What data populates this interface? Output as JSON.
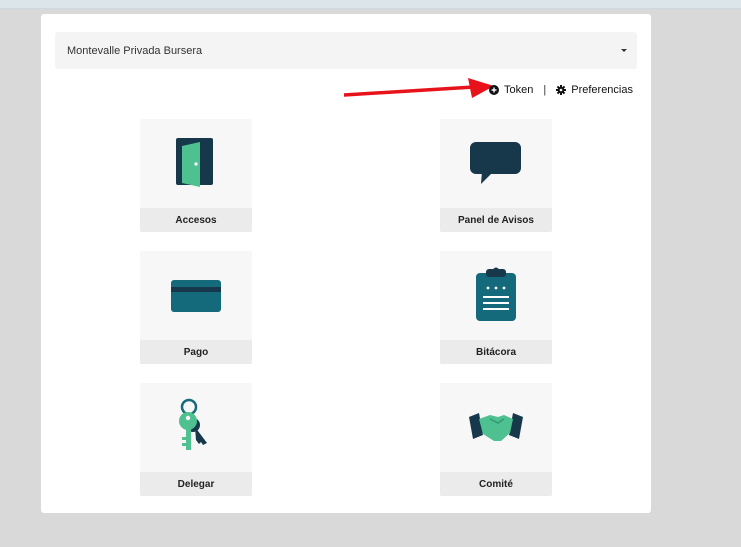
{
  "select": {
    "value": "Montevalle Privada Bursera"
  },
  "links": {
    "token_label": "Token",
    "separator": "|",
    "preferences_label": "Preferencias"
  },
  "tiles": [
    {
      "label": "Accesos",
      "icon": "door-icon"
    },
    {
      "label": "Panel de Avisos",
      "icon": "speech-bubble-icon"
    },
    {
      "label": "Pago",
      "icon": "credit-card-icon"
    },
    {
      "label": "Bitácora",
      "icon": "clipboard-icon"
    },
    {
      "label": "Delegar",
      "icon": "keys-icon"
    },
    {
      "label": "Comité",
      "icon": "handshake-icon"
    }
  ],
  "colors": {
    "dark": "#16384a",
    "teal": "#146a7a",
    "green": "#4fc190",
    "arrow": "#e8121b"
  }
}
